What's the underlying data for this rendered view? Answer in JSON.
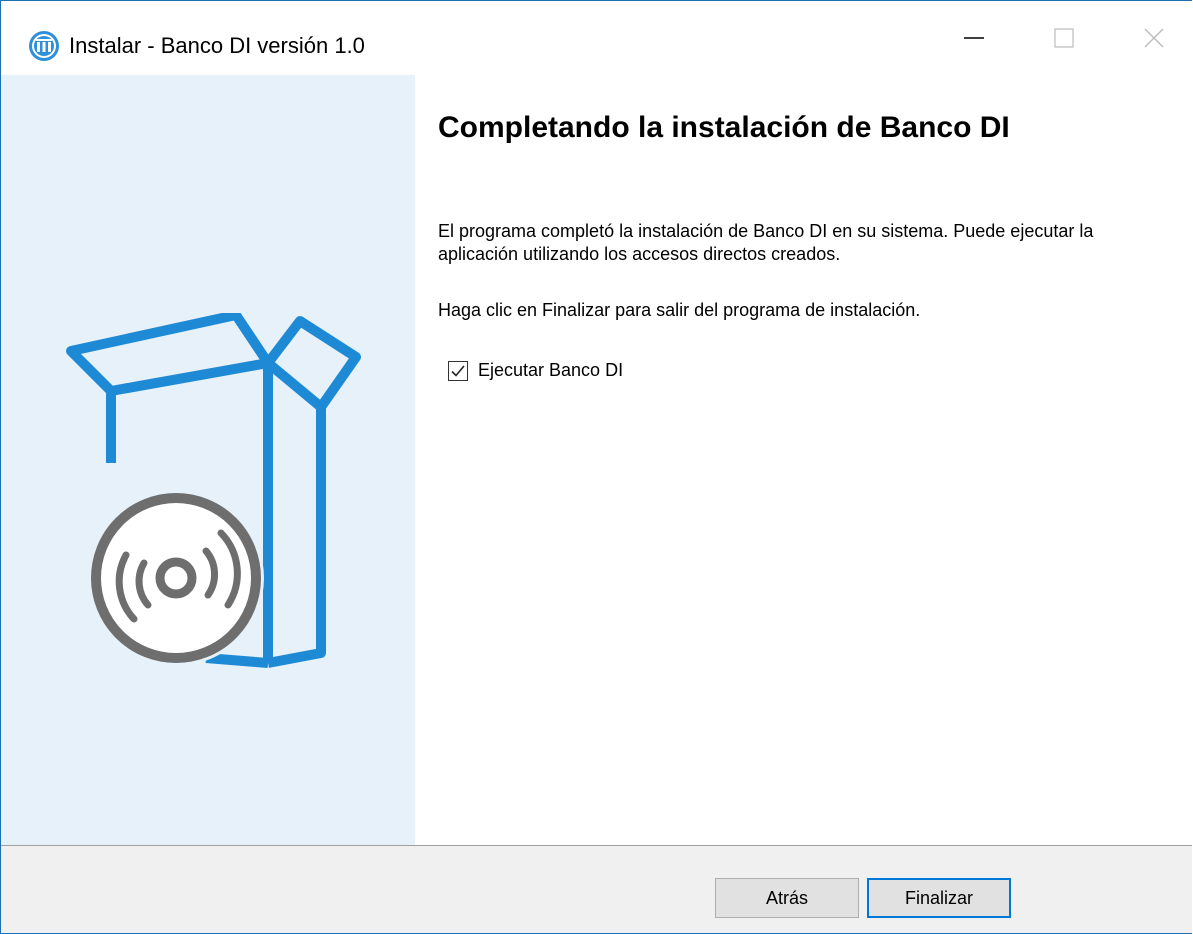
{
  "window": {
    "title": "Instalar - Banco DI versión 1.0",
    "icon": "bank-columns-icon",
    "controls": {
      "minimize_icon": "minimize-icon",
      "maximize_icon": "maximize-icon",
      "close_icon": "close-icon"
    }
  },
  "sidebar": {
    "illustration": "open-box-with-disc-icon"
  },
  "main": {
    "heading": "Completando la instalación de Banco DI",
    "paragraph1": "El programa completó la instalación de Banco DI en su sistema. Puede ejecutar la aplicación utilizando los accesos directos creados.",
    "paragraph2": "Haga clic en Finalizar para salir del programa de instalación.",
    "run_checkbox": {
      "label": "Ejecutar Banco DI",
      "checked": true
    }
  },
  "footer": {
    "back_label": "Atrás",
    "finish_label": "Finalizar"
  },
  "colors": {
    "accent": "#0078d7",
    "sidebar_bg": "#e6f1fa",
    "illustration_blue": "#1e8ad6",
    "illustration_gray": "#6e6e6e"
  }
}
